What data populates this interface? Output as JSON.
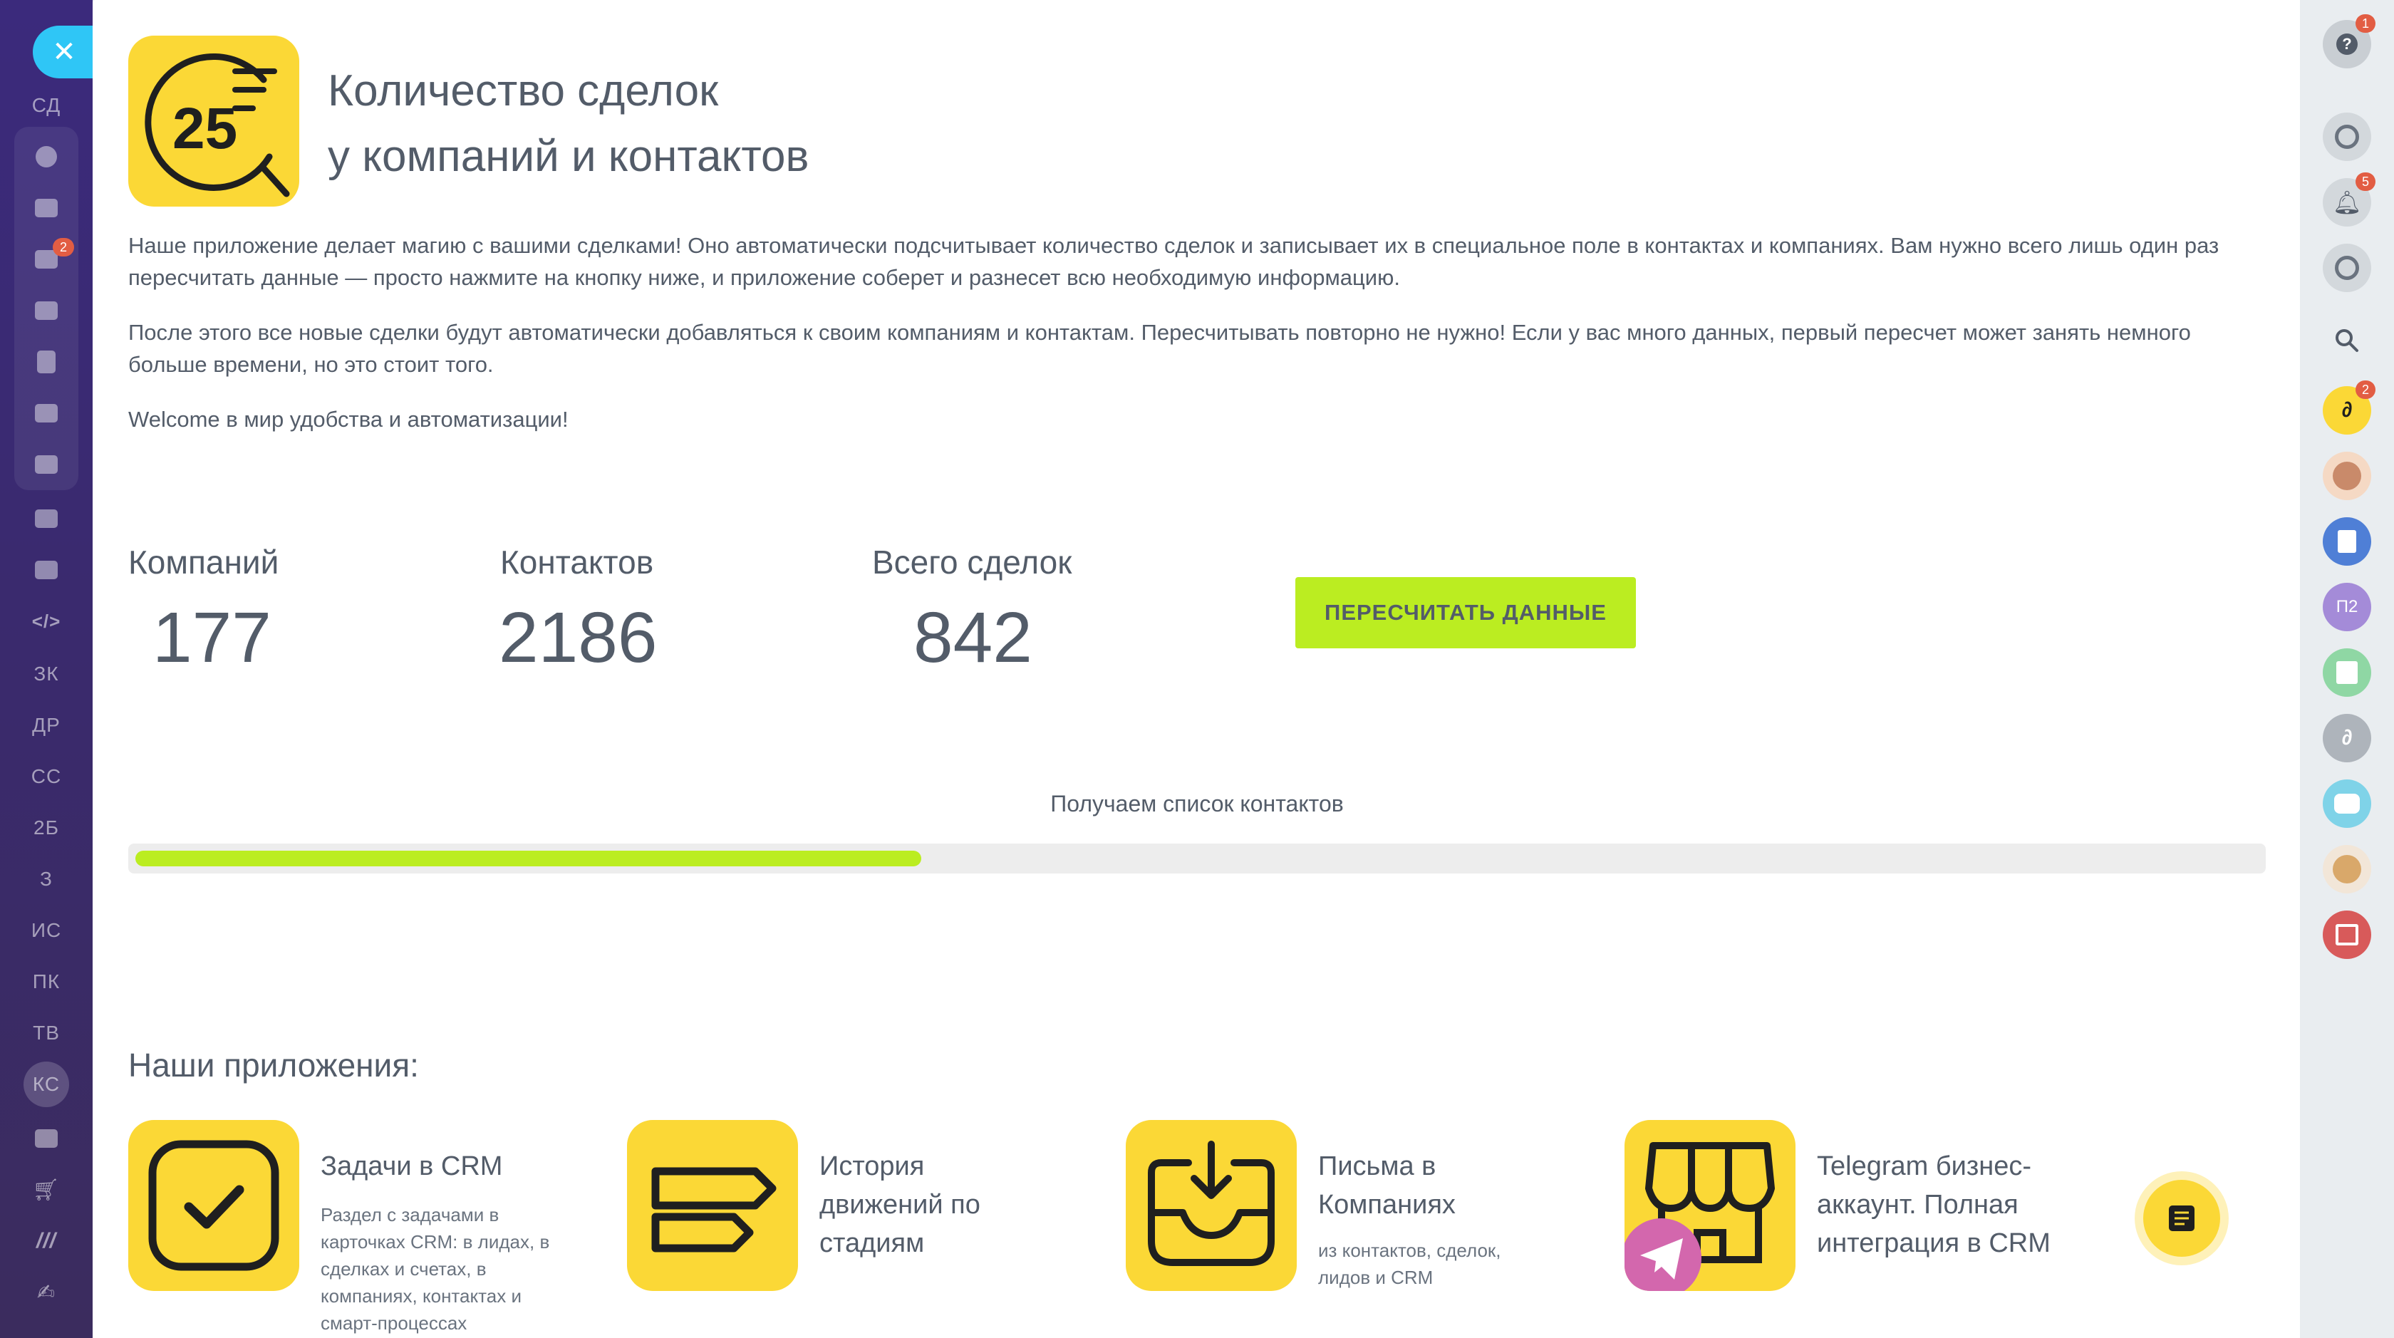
{
  "left_sidebar": {
    "close_symbol": "✕",
    "items": [
      {
        "label": "СД"
      },
      {
        "label": "ЗК"
      },
      {
        "label": "ДР"
      },
      {
        "label": "СС"
      },
      {
        "label": "2Б"
      },
      {
        "label": "З"
      },
      {
        "label": "ИС"
      },
      {
        "label": "ПК"
      },
      {
        "label": "ТВ"
      },
      {
        "label": "КС"
      }
    ],
    "chat_badge": "2"
  },
  "app": {
    "logo_number": "25",
    "title_line1": "Количество сделок",
    "title_line2": "у компаний и контактов",
    "paragraph1": "Наше приложение делает магию с вашими сделками! Оно автоматически подсчитывает количество сделок и записывает их в специальное поле в контактах и компаниях. Вам нужно всего лишь один раз пересчитать данные — просто нажмите на кнопку ниже, и приложение соберет и разнесет всю необходимую информацию.",
    "paragraph2": "После этого все новые сделки будут автоматически добавляться к своим компаниям и контактам. Пересчитывать повторно не нужно! Если у вас много данных, первый пересчет может занять немного больше времени, но это стоит того.",
    "paragraph3": "Welcome в мир удобства и автоматизации!"
  },
  "stats": {
    "companies_label": "Компаний",
    "companies_value": "177",
    "contacts_label": "Контактов",
    "contacts_value": "2186",
    "deals_label": "Всего сделок",
    "deals_value": "842"
  },
  "recalc_button": "ПЕРЕСЧИТАТЬ ДАННЫЕ",
  "progress": {
    "caption": "Получаем список контактов",
    "fraction": 0.37
  },
  "apps_section": {
    "title": "Наши приложения:",
    "apps": [
      {
        "name": "Задачи в CRM",
        "description": "Раздел с задачами в карточках CRM: в лидах, в сделках и счетах, в компаниях, контактах и смарт-процессах",
        "icon": "checkbox-icon"
      },
      {
        "name": "История движений по стадиям",
        "description": "",
        "icon": "signpost-icon"
      },
      {
        "name": "Письма в Компаниях",
        "description": "из контактов, сделок, лидов и CRM",
        "icon": "inbox-download-icon"
      },
      {
        "name": "Telegram бизнес-аккаунт. Полная интеграция в CRM",
        "description": "",
        "icon": "storefront-telegram-icon"
      }
    ]
  },
  "right_sidebar": {
    "help_badge": "1",
    "notifications_badge": "5",
    "app_badge": "2",
    "group_chat_label": "П2"
  },
  "colors": {
    "accent_yellow": "#fbd836",
    "button_green": "#bbed21",
    "text": "#535c69",
    "sidebar_purple": "#3b2a7c",
    "close_blue": "#2fc6f6",
    "badge_red": "#e25d43"
  }
}
